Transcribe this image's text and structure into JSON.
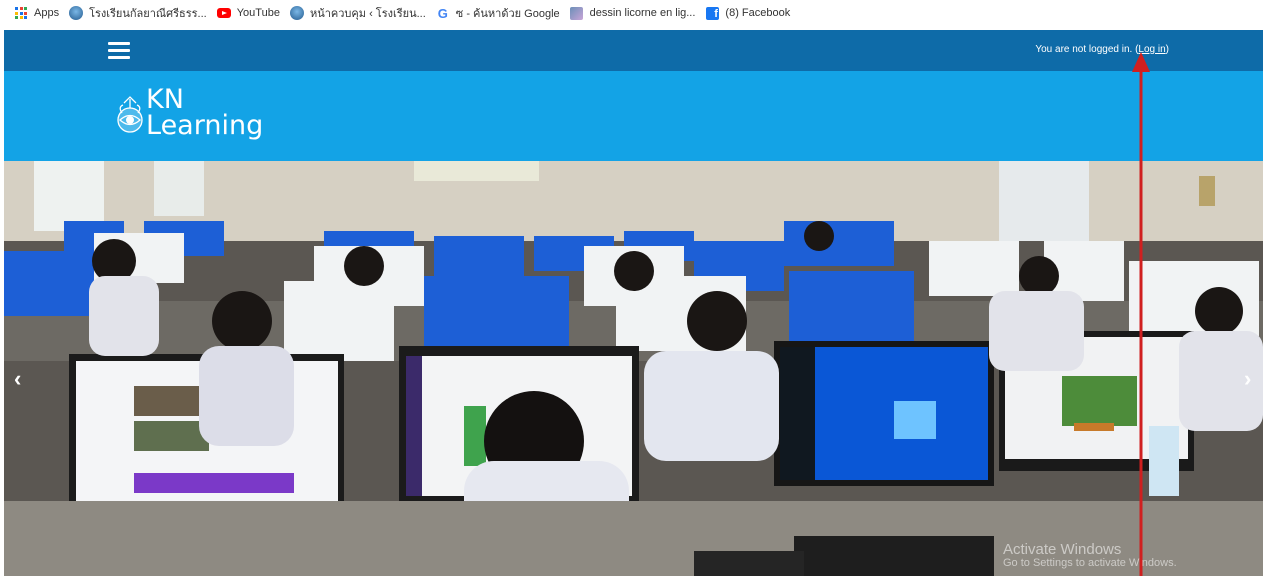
{
  "bookmarks": [
    {
      "label": "Apps",
      "icon": "apps-grid-icon"
    },
    {
      "label": "โรงเรียนกัลยาณีศรีธรร...",
      "icon": "school-logo-icon"
    },
    {
      "label": "YouTube",
      "icon": "youtube-icon"
    },
    {
      "label": "หน้าควบคุม ‹ โรงเรียน...",
      "icon": "school-logo-icon"
    },
    {
      "label": "ซ - ค้นหาด้วย Google",
      "icon": "google-icon"
    },
    {
      "label": "dessin licorne en lig...",
      "icon": "thumbnail-icon"
    },
    {
      "label": "(8) Facebook",
      "icon": "facebook-icon"
    }
  ],
  "navbar": {
    "login_prefix": "You are not logged in. (",
    "login_link": "Log in",
    "login_suffix": ")",
    "color": "#0e6ba8"
  },
  "header": {
    "logo_line1": "KN",
    "logo_line2": "Learning",
    "color": "#13a3e6"
  },
  "carousel": {
    "prev": "‹",
    "next": "›"
  },
  "watermark": {
    "title": "Activate Windows",
    "subtitle": "Go to Settings to activate Windows."
  },
  "annotation": {
    "arrow_color": "#d01f1f"
  }
}
